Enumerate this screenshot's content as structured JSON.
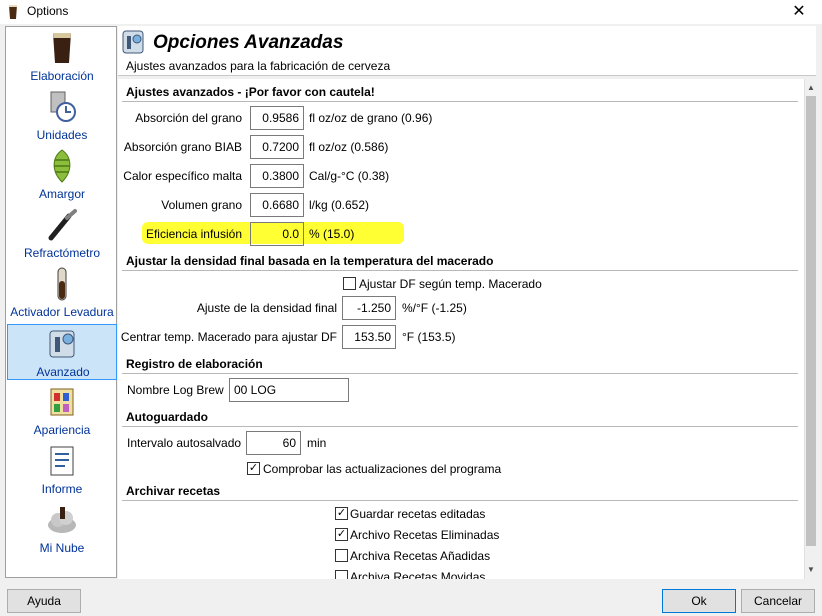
{
  "window": {
    "title": "Options",
    "close_glyph": "✕"
  },
  "sidebar": {
    "items": [
      {
        "label": "Elaboración",
        "icon": "beer-glass-icon"
      },
      {
        "label": "Unidades",
        "icon": "units-clock-icon"
      },
      {
        "label": "Amargor",
        "icon": "hop-icon"
      },
      {
        "label": "Refractómetro",
        "icon": "refractometer-icon"
      },
      {
        "label": "Activador Levadura",
        "icon": "test-tube-icon"
      },
      {
        "label": "Avanzado",
        "icon": "advanced-gear-icon"
      },
      {
        "label": "Apariencia",
        "icon": "palette-icon"
      },
      {
        "label": "Informe",
        "icon": "report-icon"
      },
      {
        "label": "Mi Nube",
        "icon": "cloud-icon"
      }
    ],
    "selected": "Avanzado"
  },
  "header": {
    "title": "Opciones Avanzadas",
    "subtitle": "Ajustes avanzados para la fabricación de cerveza"
  },
  "sections": {
    "advanced": {
      "title": "Ajustes avanzados - ¡Por favor con cautela!",
      "rows": [
        {
          "label": "Absorción del grano",
          "value": "0.9586",
          "unit": "fl oz/oz de grano (0.96)"
        },
        {
          "label": "Absorción grano BIAB",
          "value": "0.7200",
          "unit": "fl oz/oz (0.586)"
        },
        {
          "label": "Calor específico malta",
          "value": "0.3800",
          "unit": "Cal/g-°C (0.38)"
        },
        {
          "label": "Volumen grano",
          "value": "0.6680",
          "unit": "l/kg (0.652)"
        },
        {
          "label": "Eficiencia infusión",
          "value": "0.0",
          "unit": "% (15.0)"
        }
      ]
    },
    "fg": {
      "title": "Ajustar la densidad final basada en la temperatura del macerado",
      "checkbox": "Ajustar DF según temp. Macerado",
      "adj_label": "Ajuste de la densidad final",
      "adj_value": "-1.250",
      "adj_unit": "%/°F (-1.25)",
      "center_label": "Centrar temp. Macerado para ajustar DF",
      "center_value": "153.50",
      "center_unit": "°F (153.5)"
    },
    "log": {
      "title": "Registro de elaboración",
      "label": "Nombre Log Brew",
      "value": "00 LOG"
    },
    "autosave": {
      "title": "Autoguardado",
      "label": "Intervalo autosalvado",
      "value": "60",
      "unit": "min",
      "check_label": "Comprobar las actualizaciones del programa",
      "check_checked": true
    },
    "archive": {
      "title": "Archivar recetas",
      "items": [
        {
          "label": "Guardar recetas editadas",
          "checked": true
        },
        {
          "label": "Archivo Recetas Eliminadas",
          "checked": true
        },
        {
          "label": "Archiva Recetas Añadidas",
          "checked": false
        },
        {
          "label": "Archiva Recetas Movidas",
          "checked": false
        }
      ]
    }
  },
  "footer": {
    "help": "Ayuda",
    "ok": "Ok",
    "cancel": "Cancelar"
  },
  "colors": {
    "highlight": "#ffff33",
    "selection": "#cce4f7",
    "link": "#003399"
  }
}
